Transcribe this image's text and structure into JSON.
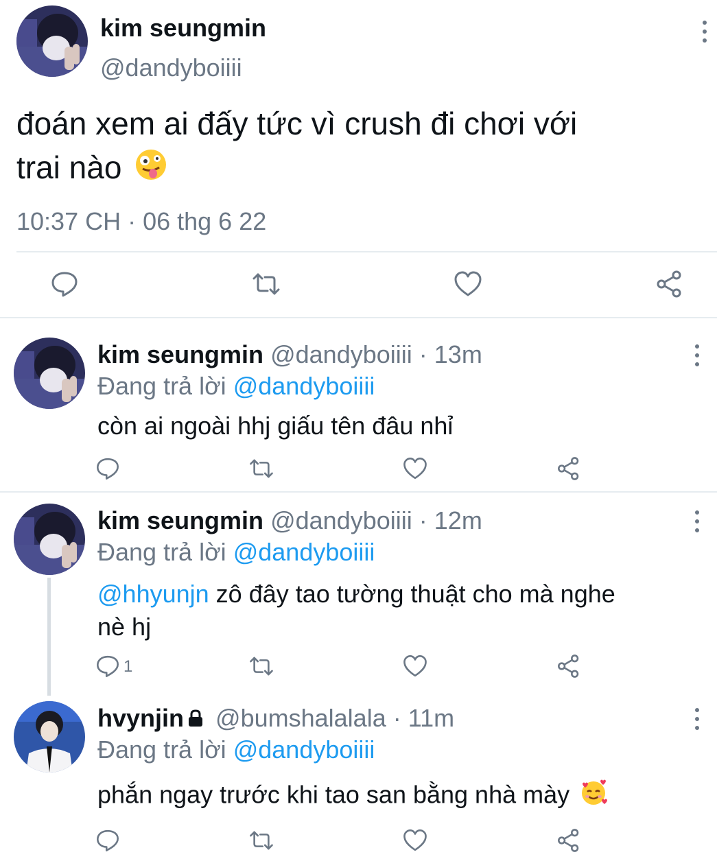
{
  "main_tweet": {
    "display_name": "kim seungmin",
    "handle": "@dandyboiiii",
    "text": "đoán xem ai đấy tức vì crush đi chơi với",
    "text_line2": "trai nào",
    "emoji_icon": "zany-face-emoji",
    "timestamp": "10:37 CH · 06 thg 6 22",
    "actions": [
      "reply-icon",
      "retweet-icon",
      "like-icon",
      "share-icon"
    ]
  },
  "replies": [
    {
      "display_name": "kim seungmin",
      "handle": "@dandyboiiii",
      "separator": "·",
      "time": "13m",
      "replying_prefix": "Đang trả lời",
      "replying_to": "@dandyboiiii",
      "text": "còn ai ngoài hhj giấu tên đâu nhỉ",
      "reply_count": ""
    },
    {
      "display_name": "kim seungmin",
      "handle": "@dandyboiiii",
      "separator": "·",
      "time": "12m",
      "replying_prefix": "Đang trả lời",
      "replying_to": "@dandyboiiii",
      "mention": "@hhyunjn",
      "text": "zô đây tao tường thuật cho mà nghe",
      "text_line2": "nè hj",
      "reply_count": "1"
    },
    {
      "display_name": "hvynjin",
      "protected_icon": "lock-icon",
      "handle": "@bumshalalala",
      "separator": "·",
      "time": "11m",
      "replying_prefix": "Đang trả lời",
      "replying_to": "@dandyboiiii",
      "text": "phắn ngay trước khi tao san bằng nhà mày",
      "emoji_icon": "smiling-face-with-hearts-emoji",
      "reply_count": ""
    }
  ],
  "colors": {
    "text": "#0f1419",
    "secondary": "#6b7785",
    "accent": "#1d9bf0",
    "divider": "#e6ecf0"
  }
}
